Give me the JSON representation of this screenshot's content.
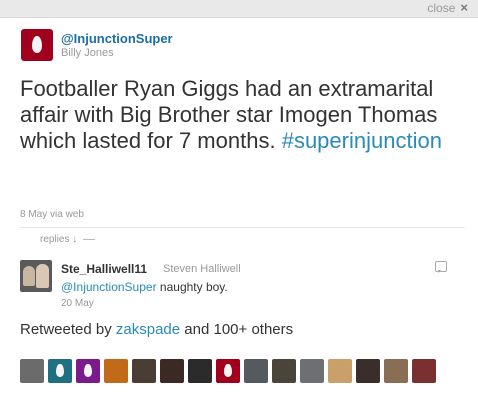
{
  "window": {
    "close_label": "close",
    "close_icon": "×"
  },
  "tweet": {
    "handle": "@InjunctionSuper",
    "name": "Billy Jones",
    "text_main": "Footballer Ryan Giggs had an extramarital affair with Big Brother star Imogen Thomas which lasted for 7 months.",
    "hashtag": "#superinjunction",
    "meta": "8 May via web"
  },
  "replies_label": "replies ↓",
  "reply": {
    "username": "Ste_Halliwell11",
    "name": "Steven Halliwell",
    "mention": "@InjunctionSuper",
    "text": "naughty boy.",
    "date": "20 May"
  },
  "retweet": {
    "prefix": "Retweeted by",
    "user": "zakspade",
    "suffix": "and 100+ others"
  },
  "colors": {
    "link": "#2a8ab8",
    "egg": "#a0001e"
  },
  "retweeters": [
    {
      "icon": "cat-avatar",
      "color": "#6b6b6b"
    },
    {
      "icon": "egg-avatar",
      "color": "#1f6f82"
    },
    {
      "icon": "egg-avatar",
      "color": "#7a1a8c"
    },
    {
      "icon": "photo-avatar",
      "color": "#c06a1a"
    },
    {
      "icon": "photo-avatar",
      "color": "#4a3d36"
    },
    {
      "icon": "photo-avatar",
      "color": "#3b2a24"
    },
    {
      "icon": "photo-avatar",
      "color": "#2b2b2b"
    },
    {
      "icon": "egg-avatar",
      "color": "#a0001e"
    },
    {
      "icon": "photo-avatar",
      "color": "#555a60"
    },
    {
      "icon": "photo-avatar",
      "color": "#4d4439"
    },
    {
      "icon": "photo-avatar",
      "color": "#6d6f73"
    },
    {
      "icon": "photo-avatar",
      "color": "#c9a06a"
    },
    {
      "icon": "photo-avatar",
      "color": "#3a2e2a"
    },
    {
      "icon": "photo-avatar",
      "color": "#8a6d55"
    },
    {
      "icon": "photo-avatar",
      "color": "#7a3030"
    }
  ]
}
